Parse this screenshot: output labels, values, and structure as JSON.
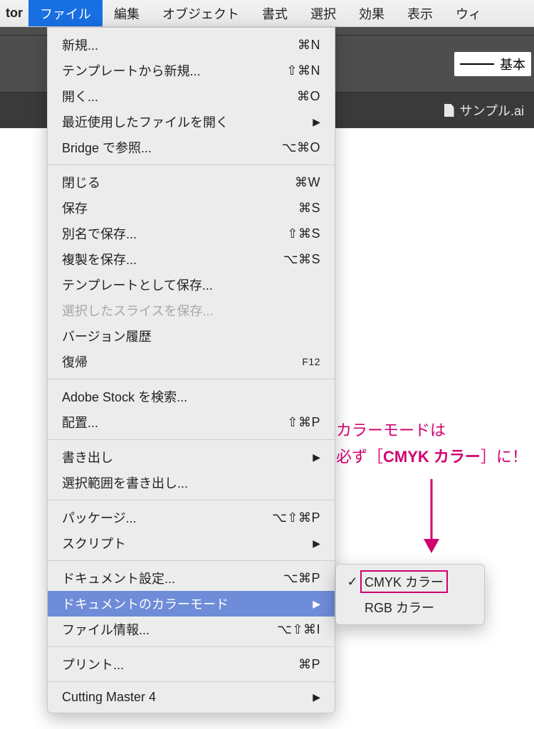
{
  "app_fragment": "tor",
  "menus": {
    "file": "ファイル",
    "edit": "編集",
    "object": "オブジェクト",
    "type": "書式",
    "select": "選択",
    "effect": "効果",
    "view": "表示",
    "window": "ウィ"
  },
  "stroke_label": "基本",
  "doc_tab": "サンプル.ai",
  "file_menu": {
    "new": "新規...",
    "new_sc": "⌘N",
    "new_template": "テンプレートから新規...",
    "new_template_sc": "⇧⌘N",
    "open": "開く...",
    "open_sc": "⌘O",
    "open_recent": "最近使用したファイルを開く",
    "browse_bridge": "Bridge で参照...",
    "browse_bridge_sc": "⌥⌘O",
    "close": "閉じる",
    "close_sc": "⌘W",
    "save": "保存",
    "save_sc": "⌘S",
    "save_as": "別名で保存...",
    "save_as_sc": "⇧⌘S",
    "save_copy": "複製を保存...",
    "save_copy_sc": "⌥⌘S",
    "save_template": "テンプレートとして保存...",
    "save_slices": "選択したスライスを保存...",
    "version_history": "バージョン履歴",
    "revert": "復帰",
    "revert_sc": "F12",
    "search_stock": "Adobe Stock を検索...",
    "place": "配置...",
    "place_sc": "⇧⌘P",
    "export": "書き出し",
    "export_selection": "選択範囲を書き出し...",
    "package": "パッケージ...",
    "package_sc": "⌥⇧⌘P",
    "scripts": "スクリプト",
    "doc_setup": "ドキュメント設定...",
    "doc_setup_sc": "⌥⌘P",
    "color_mode": "ドキュメントのカラーモード",
    "file_info": "ファイル情報...",
    "file_info_sc": "⌥⇧⌘I",
    "print": "プリント...",
    "print_sc": "⌘P",
    "cutting": "Cutting Master 4"
  },
  "submenu": {
    "cmyk": "CMYK カラー",
    "rgb": "RGB カラー"
  },
  "annotation": {
    "line1": "カラーモードは",
    "line2a": "必ず［",
    "line2b": "CMYK カラー",
    "line2c": "］に！"
  }
}
